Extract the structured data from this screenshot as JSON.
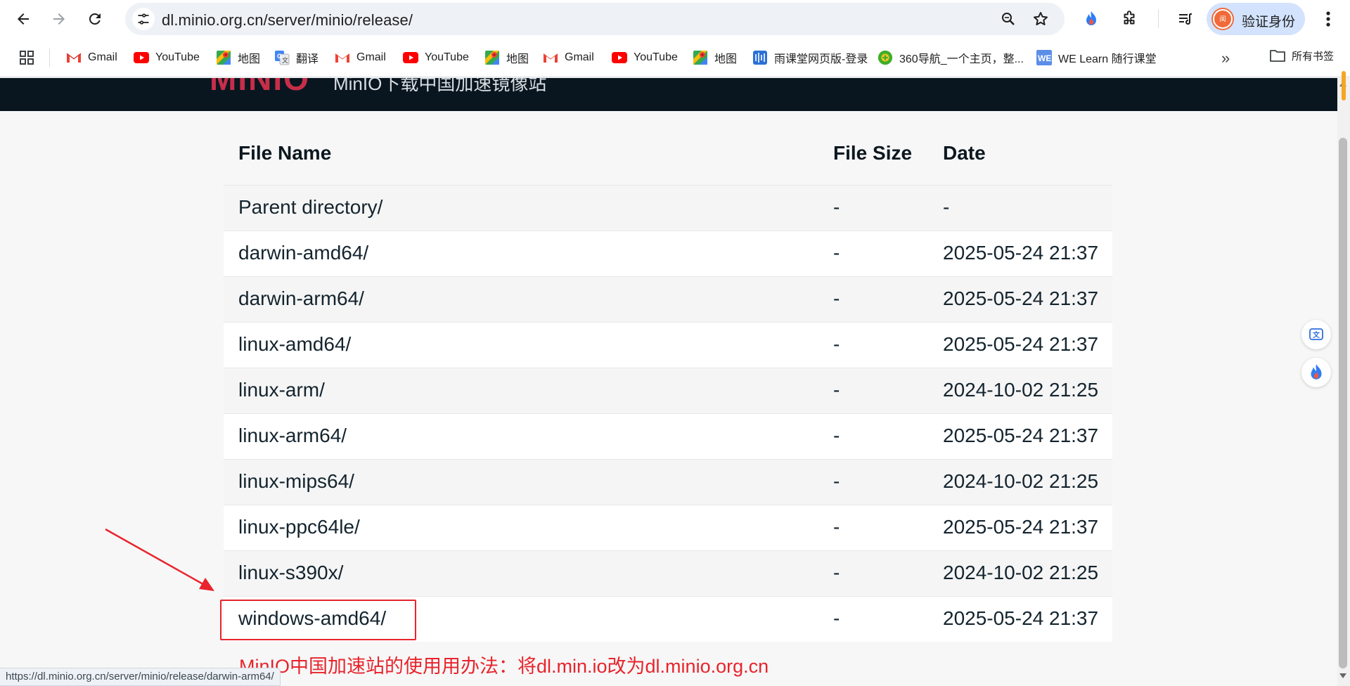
{
  "browser": {
    "url": "dl.minio.org.cn/server/minio/release/",
    "profile_label": "验证身份",
    "avatar_text": "阅"
  },
  "bookmarks": {
    "items": [
      {
        "label": "Gmail",
        "icon": "gmail-icon"
      },
      {
        "label": "YouTube",
        "icon": "youtube-icon"
      },
      {
        "label": "地图",
        "icon": "maps-icon"
      },
      {
        "label": "翻译",
        "icon": "translate-icon"
      },
      {
        "label": "Gmail",
        "icon": "gmail-icon"
      },
      {
        "label": "YouTube",
        "icon": "youtube-icon"
      },
      {
        "label": "地图",
        "icon": "maps-icon"
      },
      {
        "label": "Gmail",
        "icon": "gmail-icon"
      },
      {
        "label": "YouTube",
        "icon": "youtube-icon"
      },
      {
        "label": "地图",
        "icon": "maps-icon"
      },
      {
        "label": "雨课堂网页版-登录",
        "icon": "rain-classroom-icon"
      },
      {
        "label": "360导航_一个主页，整...",
        "icon": "360-nav-icon"
      },
      {
        "label": "WE Learn 随行课堂",
        "icon": "welearn-icon"
      }
    ],
    "more": "»",
    "all_bookmarks": "所有书签"
  },
  "page": {
    "header_logo": "MINIO",
    "header_title": "MinIO下载中国加速镜像站",
    "columns": {
      "name": "File Name",
      "size": "File Size",
      "date": "Date"
    },
    "rows": [
      {
        "name": "Parent directory/",
        "size": "-",
        "date": "-"
      },
      {
        "name": "darwin-amd64/",
        "size": "-",
        "date": "2025-05-24 21:37"
      },
      {
        "name": "darwin-arm64/",
        "size": "-",
        "date": "2025-05-24 21:37"
      },
      {
        "name": "linux-amd64/",
        "size": "-",
        "date": "2025-05-24 21:37"
      },
      {
        "name": "linux-arm/",
        "size": "-",
        "date": "2024-10-02 21:25"
      },
      {
        "name": "linux-arm64/",
        "size": "-",
        "date": "2025-05-24 21:37"
      },
      {
        "name": "linux-mips64/",
        "size": "-",
        "date": "2024-10-02 21:25"
      },
      {
        "name": "linux-ppc64le/",
        "size": "-",
        "date": "2025-05-24 21:37"
      },
      {
        "name": "linux-s390x/",
        "size": "-",
        "date": "2024-10-02 21:25"
      },
      {
        "name": "windows-amd64/",
        "size": "-",
        "date": "2025-05-24 21:37"
      }
    ],
    "note": "MinIO中国加速站的使用用办法：将dl.min.io改为dl.minio.org.cn"
  },
  "status_bar": "https://dl.minio.org.cn/server/minio/release/darwin-arm64/",
  "colors": {
    "header_bg": "#091620",
    "logo": "#c72e49",
    "annotation_red": "#e8242c",
    "profile_bg": "#d3e3fd"
  }
}
